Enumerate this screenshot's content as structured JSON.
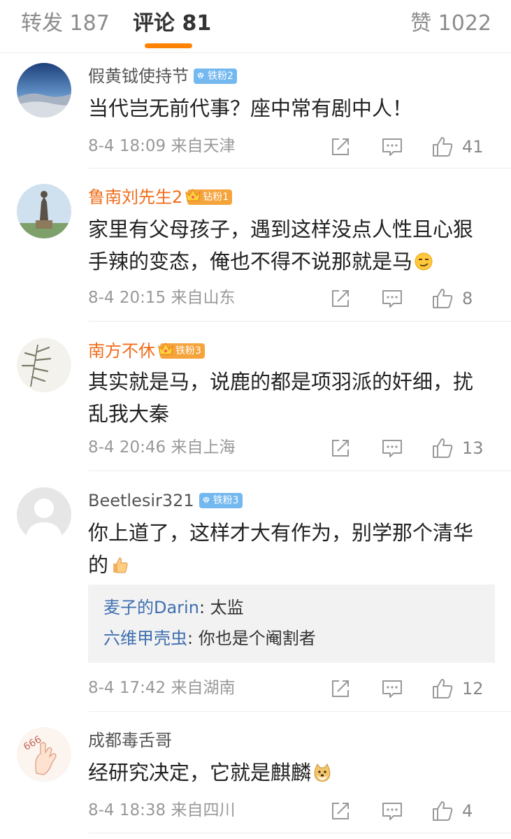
{
  "tabs": {
    "repost": "转发 187",
    "comments": "评论 81",
    "likes": "赞 1022",
    "accent": "#ff8200"
  },
  "comments": [
    {
      "username": "假黄钺使持节",
      "badge": "铁粉2",
      "badge_type": "iron",
      "text": "当代岂无前代事？座中常有剧中人！",
      "time": "8-4 18:09",
      "location": "来自天津",
      "likes": "41"
    },
    {
      "username": "鲁南刘先生2",
      "badge": "钻粉1",
      "badge_type": "diamond",
      "text": "家里有父母孩子，遇到这样没点人性且心狠\n手辣的变态，俺也不得不说那就是马",
      "emoji": "smirk-emoji",
      "time": "8-4 20:15",
      "location": "来自山东",
      "likes": "8"
    },
    {
      "username": "南方不休",
      "badge": "铁粉3",
      "badge_type": "diamond",
      "text": "其实就是马，说鹿的都是项羽派的奸细，扰\n乱我大秦",
      "time": "8-4 20:46",
      "location": "来自上海",
      "likes": "13"
    },
    {
      "username": "Beetlesir321",
      "badge": "铁粉3",
      "badge_type": "iron",
      "text": "你上道了，这样才大有作为，别学那个清华\n的",
      "emoji": "thumbs-up-emoji",
      "replies": [
        {
          "user": "麦子的Darin",
          "sep": ": ",
          "text": "太监"
        },
        {
          "user": "六维甲壳虫",
          "sep": ": ",
          "text": "你也是个阉割者"
        }
      ],
      "time": "8-4 17:42",
      "location": "来自湖南",
      "likes": "12"
    },
    {
      "username": "成都毒舌哥",
      "text": "经研究决定，它就是麒麟",
      "emoji": "doge-emoji",
      "time": "8-4 18:38",
      "location": "来自四川",
      "likes": "4"
    }
  ],
  "colors": {
    "username_default": "#555555",
    "username_highlight": "#f06d1b",
    "reply_user": "#3e6fb0",
    "iron_badge": "#74b8f0",
    "diamond_badge": "#f5a33b"
  }
}
